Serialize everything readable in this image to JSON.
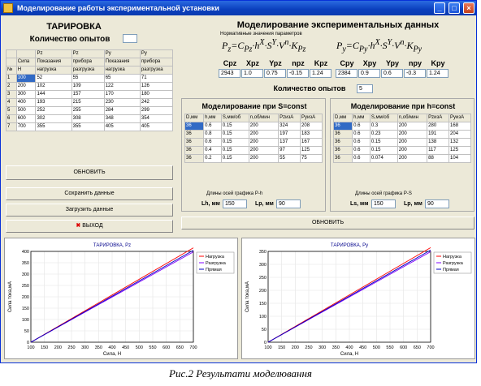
{
  "window": {
    "title": "Моделирование работы экспериментальной установки"
  },
  "tar": {
    "title": "ТАРИРОВКА",
    "count_label": "Количество опытов",
    "table": [
      [
        "",
        "",
        "Pz",
        "Pz",
        "Py",
        "Py"
      ],
      [
        "",
        "Сила",
        "Показания",
        "прибора",
        "Показания",
        "прибора"
      ],
      [
        "№",
        "Н",
        "нагрузка",
        "разгрузка",
        "нагрузка",
        "разгрузка"
      ],
      [
        "1",
        "100",
        "52",
        "55",
        "65",
        "71"
      ],
      [
        "2",
        "200",
        "102",
        "109",
        "122",
        "126"
      ],
      [
        "3",
        "300",
        "144",
        "157",
        "170",
        "180"
      ],
      [
        "4",
        "400",
        "193",
        "215",
        "230",
        "242"
      ],
      [
        "5",
        "500",
        "252",
        "255",
        "284",
        "299"
      ],
      [
        "6",
        "600",
        "302",
        "308",
        "348",
        "354"
      ],
      [
        "7",
        "700",
        "355",
        "355",
        "405",
        "405"
      ]
    ],
    "update": "ОБНОВИТЬ",
    "save": "Сохранить данные",
    "load": "Загрузить данные",
    "exit": "ВЫХОД"
  },
  "mod": {
    "title": "Моделирование экспериментальных данных",
    "norm_label": "Нормативные значения параметров",
    "headers1": [
      "Cpz",
      "Xpz",
      "Ypz",
      "npz",
      "Kpz"
    ],
    "values1": [
      "2943",
      "1.0",
      "0.75",
      "-0.15",
      "1.24"
    ],
    "headers2": [
      "Cpy",
      "Xpy",
      "Ypy",
      "npy",
      "Kpy"
    ],
    "values2": [
      "2384",
      "0.9",
      "0.6",
      "-0.3",
      "1.24"
    ],
    "count_label": "Количество опытов",
    "count": "5",
    "update": "ОБНОВИТЬ"
  },
  "s_const": {
    "title": "Моделирование при S=const",
    "rows": [
      [
        "D,мм",
        "h,мм",
        "S,мм/об",
        "n,об/мин",
        "PzизА",
        "PyизА"
      ],
      [
        "36",
        "0.6",
        "0.15",
        "200",
        "324",
        "208"
      ],
      [
        "36",
        "0.8",
        "0.15",
        "200",
        "197",
        "183"
      ],
      [
        "36",
        "0.6",
        "0.15",
        "200",
        "137",
        "167"
      ],
      [
        "36",
        "0.4",
        "0.15",
        "200",
        "97",
        "125"
      ],
      [
        "36",
        "0.2",
        "0.15",
        "200",
        "55",
        "75"
      ]
    ],
    "axis_label": "Длины осей графика P-h",
    "lh_label": "Lh, мм",
    "lh": "150",
    "lp_label": "Lp, мм",
    "lp": "90"
  },
  "h_const": {
    "title": "Моделирование при h=const",
    "rows": [
      [
        "D,мм",
        "h,мм",
        "S,мм/об",
        "n,об/мин",
        "PzизА",
        "PyизА"
      ],
      [
        "36",
        "0.6",
        "0.3",
        "200",
        "280",
        "168"
      ],
      [
        "36",
        "0.6",
        "0.23",
        "200",
        "191",
        "204"
      ],
      [
        "36",
        "0.6",
        "0.15",
        "200",
        "138",
        "132"
      ],
      [
        "36",
        "0.6",
        "0.15",
        "200",
        "117",
        "125"
      ],
      [
        "36",
        "0.6",
        "0.074",
        "200",
        "88",
        "104"
      ]
    ],
    "axis_label": "Длины осей графика P-S",
    "ls_label": "Ls, мм",
    "ls": "150",
    "lp_label": "Lp, мм",
    "lp": "90"
  },
  "chart_data": [
    {
      "type": "line",
      "title": "ТАРИРОВКА, Pz",
      "xlabel": "Сила, Н",
      "ylabel": "Сила тока,мА",
      "xlim": [
        100,
        700
      ],
      "ylim": [
        0,
        400
      ],
      "xticks": [
        100,
        150,
        200,
        250,
        300,
        350,
        400,
        450,
        500,
        550,
        600,
        650,
        700
      ],
      "yticks": [
        0,
        50,
        100,
        150,
        200,
        250,
        300,
        350,
        400
      ],
      "series": [
        {
          "name": "Нагрузка",
          "color": "#ff0000",
          "x": [
            100,
            700
          ],
          "y": [
            0,
            405
          ]
        },
        {
          "name": "Разгрузка",
          "color": "#8000ff",
          "x": [
            100,
            700
          ],
          "y": [
            0,
            405
          ]
        },
        {
          "name": "Прямая",
          "color": "#0000c0",
          "x": [
            100,
            700
          ],
          "y": [
            0,
            405
          ]
        }
      ]
    },
    {
      "type": "line",
      "title": "ТАРИРОВКА, Py",
      "xlabel": "Сила, Н",
      "ylabel": "Сила тока,мА",
      "xlim": [
        100,
        700
      ],
      "ylim": [
        0,
        350
      ],
      "xticks": [
        100,
        150,
        200,
        250,
        300,
        350,
        400,
        450,
        500,
        550,
        600,
        650,
        700
      ],
      "yticks": [
        0,
        50,
        100,
        150,
        200,
        250,
        300,
        350
      ],
      "series": [
        {
          "name": "Нагрузка",
          "color": "#ff0000",
          "x": [
            100,
            700
          ],
          "y": [
            0,
            355
          ]
        },
        {
          "name": "Разгрузка",
          "color": "#8000ff",
          "x": [
            100,
            700
          ],
          "y": [
            0,
            355
          ]
        },
        {
          "name": "Прямая",
          "color": "#0000c0",
          "x": [
            100,
            700
          ],
          "y": [
            0,
            355
          ]
        }
      ]
    }
  ],
  "caption": "Рис.2 Результати моделювання"
}
